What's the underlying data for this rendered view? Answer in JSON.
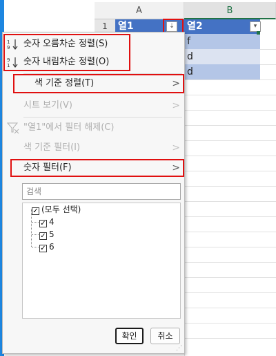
{
  "spreadsheet": {
    "col_a": "A",
    "col_b": "B",
    "row_1": "1",
    "header_col1": "열1",
    "header_col2": "열2",
    "cells_b": [
      "f",
      "d",
      "d"
    ]
  },
  "menu": {
    "sort_asc": "숫자 오름차순 정렬(S)",
    "sort_desc": "숫자 내림차순 정렬(O)",
    "sort_by_color": "색 기준 정렬(T)",
    "sheet_view": "시트 보기(V)",
    "clear_filter": "\"열1\"에서 필터 해제(C)",
    "filter_by_color": "색 기준 필터(I)",
    "number_filters": "숫자 필터(F)",
    "arrow": ">"
  },
  "search": {
    "placeholder": "검색"
  },
  "filter_list": [
    {
      "label": "(모두 선택)",
      "checked": true
    },
    {
      "label": "4",
      "checked": true
    },
    {
      "label": "5",
      "checked": true
    },
    {
      "label": "6",
      "checked": true
    }
  ],
  "buttons": {
    "ok": "확인",
    "cancel": "취소"
  },
  "colors": {
    "table_header": "#4472c4",
    "band": "#b4c6e7",
    "highlight": "#e01010",
    "excel_green": "#217346"
  }
}
